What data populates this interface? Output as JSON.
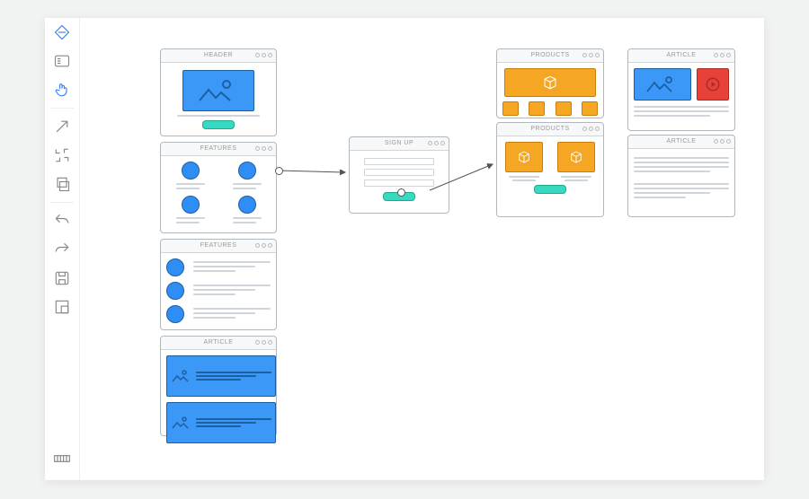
{
  "toolbar": {
    "tools": [
      {
        "name": "diamond-icon",
        "active": true
      },
      {
        "name": "list-icon"
      },
      {
        "name": "hand-pointer-icon",
        "active": true
      },
      {
        "name": "arrow-cursor-icon"
      },
      {
        "name": "crop-icon"
      },
      {
        "name": "layers-icon"
      },
      {
        "name": "undo-icon"
      },
      {
        "name": "redo-icon"
      },
      {
        "name": "save-icon"
      },
      {
        "name": "artboard-icon"
      }
    ],
    "bottom_tool": {
      "name": "dimensions-icon"
    }
  },
  "panels": {
    "header": {
      "title": "HEADER"
    },
    "features1": {
      "title": "FEATURES"
    },
    "features2": {
      "title": "FEATURES"
    },
    "article_cards": {
      "title": "ARTICLE"
    },
    "signup": {
      "title": "SIGN UP"
    },
    "products": {
      "title": "PRODUCTS"
    },
    "products2": {
      "title": "PRODUCTS"
    },
    "article_right1": {
      "title": "ARTICLE"
    },
    "article_right2": {
      "title": "ARTICLE"
    }
  },
  "colors": {
    "blue": "#3b98f7",
    "orange": "#f5a623",
    "teal": "#38d9c0",
    "red": "#e8413a"
  }
}
